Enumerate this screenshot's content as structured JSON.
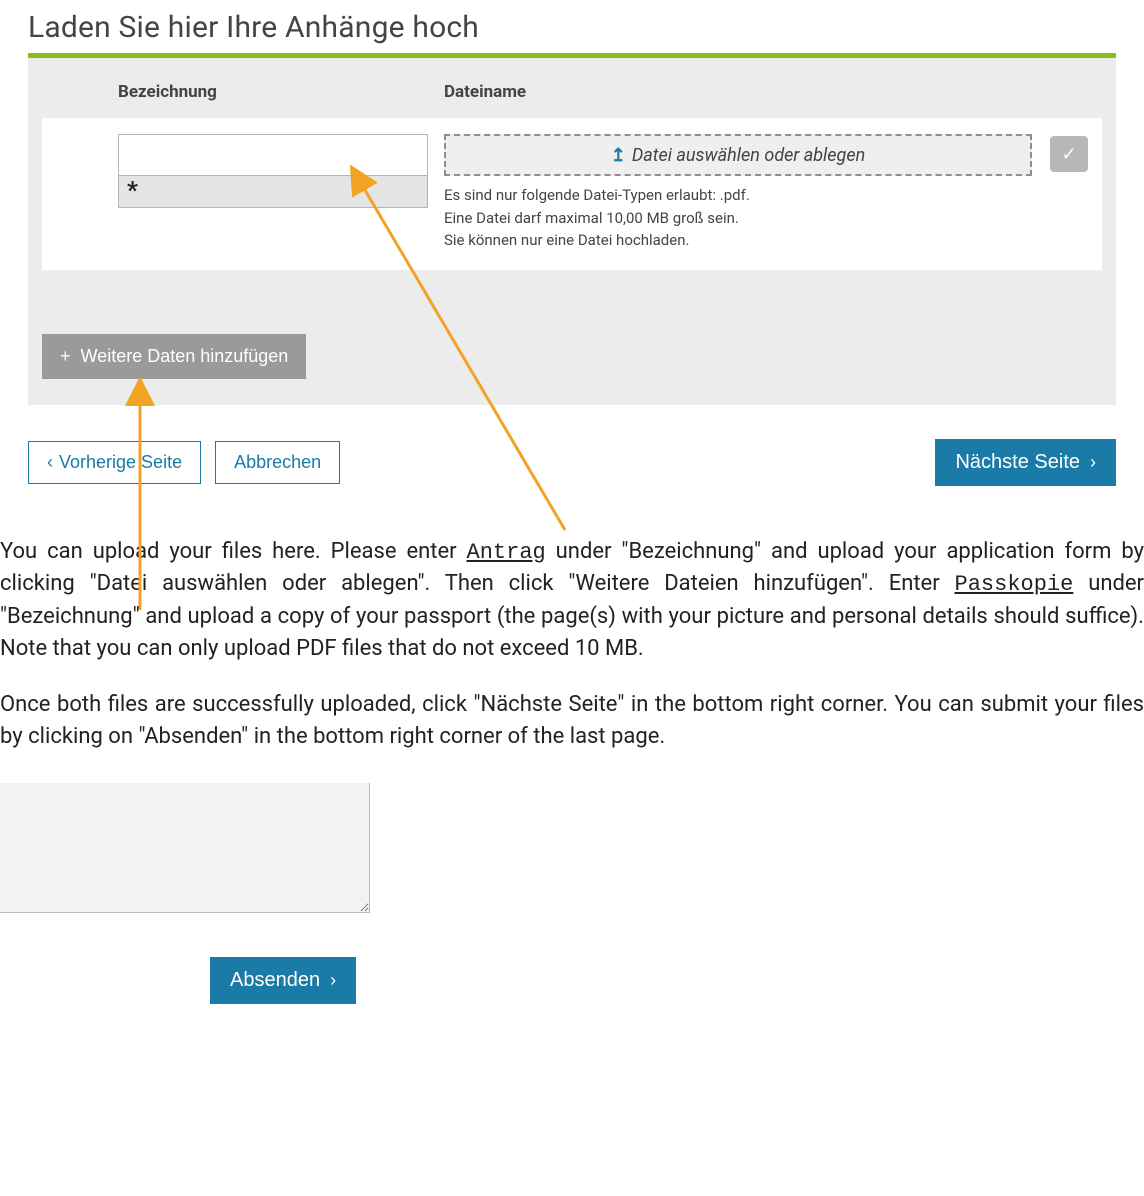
{
  "title": "Laden Sie hier Ihre Anhänge hoch",
  "headers": {
    "bezeichnung": "Bezeichnung",
    "dateiname": "Dateiname"
  },
  "row": {
    "bez_value": "",
    "asterisk": "*",
    "dropzone_label": "Datei auswählen oder ablegen",
    "hint1": "Es sind nur folgende Datei-Typen erlaubt: .pdf.",
    "hint2": "Eine Datei darf maximal 10,00 MB groß sein.",
    "hint3": "Sie können nur eine Datei hochladen."
  },
  "add_more": "Weitere Daten hinzufügen",
  "nav": {
    "prev": "Vorherige Seite",
    "cancel": "Abbrechen",
    "next": "Nächste Seite"
  },
  "instructions": {
    "p1_a": "You can upload your files here. Please enter ",
    "p1_mono1": "Antrag",
    "p1_b": " under \"Bezeichnung\" and upload your application form by clicking \"Datei auswählen oder ablegen\". Then click \"Weitere Dateien hinzufügen\". Enter ",
    "p1_mono2": "Passkopie",
    "p1_c": " under \"Bezeichnung\" and upload a copy of your passport (the page(s) with your picture and personal details should suffice). Note that you can only upload PDF files that do not exceed 10 MB.",
    "p2": "Once both files are successfully uploaded, click \"Nächste Seite\" in the bottom right corner. You can submit your files by clicking on \"Absenden\" in the bottom right corner of the last page."
  },
  "absenden": "Absenden"
}
